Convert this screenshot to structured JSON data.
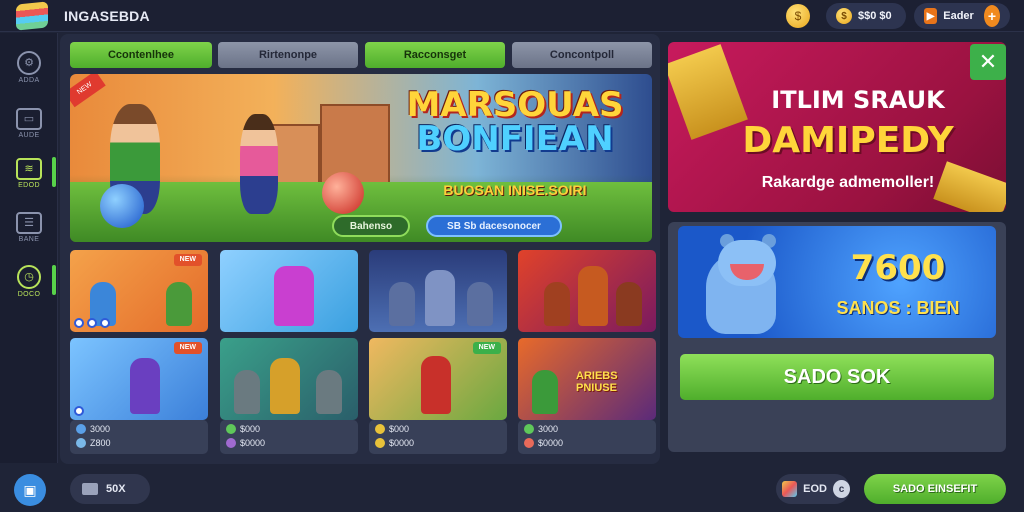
{
  "app": {
    "title": "INGASEBDA"
  },
  "topbar": {
    "coin_symbol": "$",
    "coins_label": "$$0 $0",
    "gems_label": "Eader",
    "plus": "+"
  },
  "sidebar": {
    "items": [
      {
        "label": "ADDA",
        "icon": "gear-icon"
      },
      {
        "label": "AUDE",
        "icon": "box-icon"
      },
      {
        "label": "EDOD",
        "icon": "stack-icon"
      },
      {
        "label": "BANE",
        "icon": "list-icon"
      },
      {
        "label": "DOCO",
        "icon": "clock-icon"
      }
    ],
    "active_index": 2
  },
  "tabs": [
    {
      "label": "Ccontenlhee",
      "style": "green"
    },
    {
      "label": "Rirtenonpe",
      "style": "grey"
    },
    {
      "label": "Racconsget",
      "style": "green"
    },
    {
      "label": "Concontpoll",
      "style": "grey"
    }
  ],
  "banner": {
    "title_line1": "MARSOUAS",
    "title_line2": "BONFIEAN",
    "subtitle": "BUOSAN INISE.SOIRI",
    "ribbon": "NEW",
    "play_label": "Bahenso",
    "join_label": "SB Sb dacesonocer"
  },
  "cards": [
    {
      "tag": "NEW",
      "caption": ""
    },
    {
      "tag": "",
      "caption": ""
    },
    {
      "tag": "",
      "caption": ""
    },
    {
      "tag": "",
      "caption": ""
    },
    {
      "tag": "NEW",
      "caption": ""
    },
    {
      "tag": "",
      "caption": ""
    },
    {
      "tag": "NEW",
      "caption": ""
    },
    {
      "tag": "",
      "caption": "ARIEBS PNIUSE"
    }
  ],
  "stats": [
    {
      "line1": "3000",
      "line2": "Z800"
    },
    {
      "line1": "$000",
      "line2": "$0000"
    },
    {
      "line1": "$000",
      "line2": "$0000"
    },
    {
      "line1": "3000",
      "line2": "$0000"
    }
  ],
  "promo": {
    "line1": "ITLIM SRAUK",
    "line2": "DAMIPEDY",
    "line3": "Rakardge admemoller!",
    "close": "✕"
  },
  "reward": {
    "amount": "7600",
    "code": "SANOS : BIEN"
  },
  "claim_button": "SADO SOK",
  "bottom": {
    "left_pill": "50X",
    "right_pill": "EOD",
    "right_icon_text": "c",
    "action_button": "SADO EINSEFIT"
  }
}
